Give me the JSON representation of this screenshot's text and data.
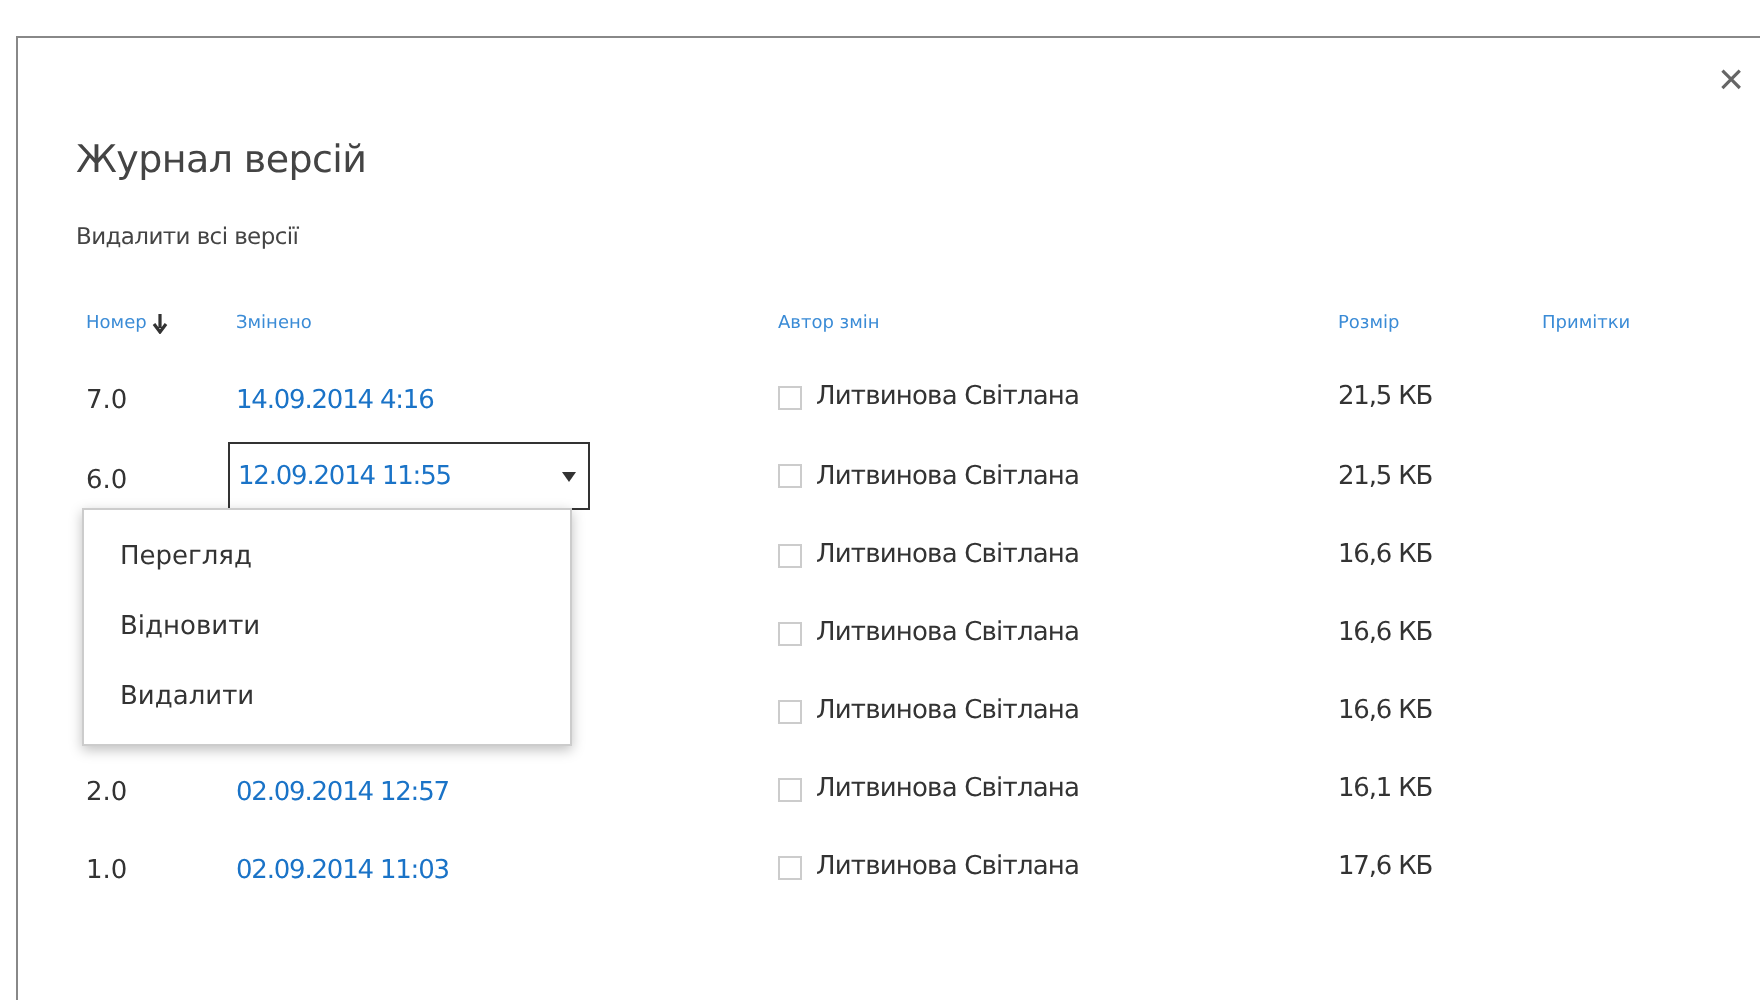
{
  "dialog": {
    "title": "Журнал версій",
    "close": "×",
    "delete_all": "Видалити всі версії"
  },
  "table": {
    "columns": [
      {
        "label": "Номер",
        "sorted": true
      },
      {
        "label": "Змінено",
        "sorted": false
      },
      {
        "label": "Автор змін",
        "sorted": false
      },
      {
        "label": "Розмір",
        "sorted": false
      },
      {
        "label": "Примітки",
        "sorted": false
      }
    ],
    "rows": [
      {
        "number": "7.0",
        "modified": "14.09.2014 4:16",
        "author": "Литвинова Світлана",
        "size": "21,5 КБ",
        "selected": false
      },
      {
        "number": "6.0",
        "modified": "12.09.2014 11:55",
        "author": "Литвинова Світлана",
        "size": "21,5 КБ",
        "selected": true
      },
      {
        "author": "Литвинова Світлана",
        "size": "16,6 КБ",
        "selected": false
      },
      {
        "author": "Литвинова Світлана",
        "size": "16,6 КБ",
        "selected": false
      },
      {
        "author": "Литвинова Світлана",
        "size": "16,6 КБ",
        "selected": false
      },
      {
        "number": "2.0",
        "modified": "02.09.2014 12:57",
        "author": "Литвинова Світлана",
        "size": "16,1 КБ",
        "selected": false
      },
      {
        "number": "1.0",
        "modified": "02.09.2014 11:03",
        "author": "Литвинова Світлана",
        "size": "17,6 КБ",
        "selected": false
      }
    ]
  },
  "context_menu": {
    "items": [
      "Перегляд",
      "Відновити",
      "Видалити"
    ]
  }
}
